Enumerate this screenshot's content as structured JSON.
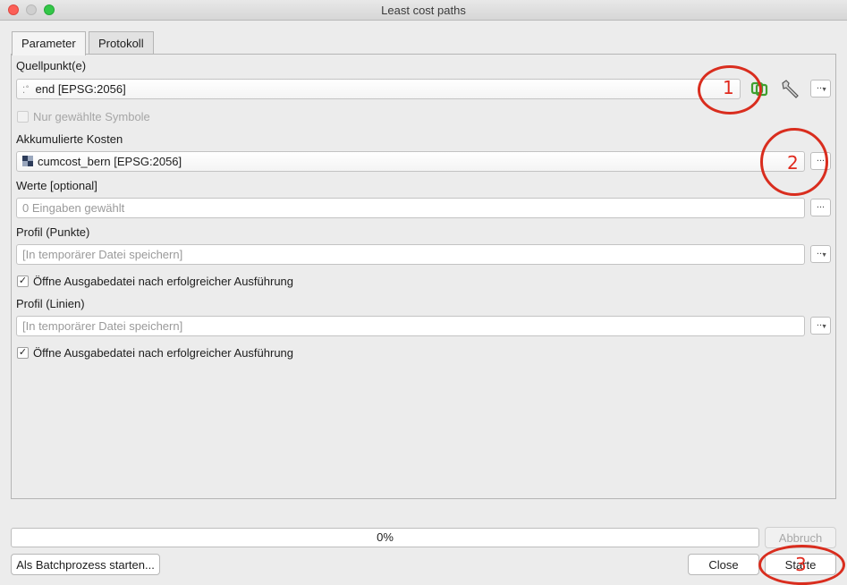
{
  "window": {
    "title": "Least cost paths"
  },
  "tabs": [
    {
      "label": "Parameter",
      "active": true
    },
    {
      "label": "Protokoll",
      "active": false
    }
  ],
  "source_points": {
    "label": "Quellpunkt(e)",
    "value": "end [EPSG:2056]",
    "selected_only_label": "Nur gewählte Symbole",
    "selected_only_checked": false,
    "selected_only_enabled": false
  },
  "accumulated_cost": {
    "label": "Akkumulierte Kosten",
    "value": "cumcost_bern [EPSG:2056]"
  },
  "values": {
    "label": "Werte [optional]",
    "placeholder": "0 Eingaben gewählt"
  },
  "profile_points": {
    "label": "Profil (Punkte)",
    "placeholder": "[In temporärer Datei speichern]",
    "open_after_label": "Öffne Ausgabedatei nach erfolgreicher Ausführung",
    "open_after_checked": true
  },
  "profile_lines": {
    "label": "Profil (Linien)",
    "placeholder": "[In temporärer Datei speichern]",
    "open_after_label": "Öffne Ausgabedatei nach erfolgreicher Ausführung",
    "open_after_checked": true
  },
  "dots_label": "...",
  "check_mark": "✓",
  "progress": {
    "value": 0,
    "text": "0%"
  },
  "buttons": {
    "cancel": "Abbruch",
    "batch": "Als Batchprozess starten...",
    "close": "Close",
    "start": "Starte"
  },
  "annotations": [
    "1",
    "2",
    "3"
  ],
  "colors": {
    "annotation": "#e02a1e",
    "iterate_icon": "#3fa02f"
  }
}
